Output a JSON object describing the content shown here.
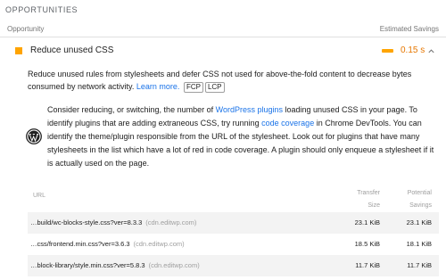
{
  "section": {
    "title": "OPPORTUNITIES"
  },
  "columns": {
    "opportunity": "Opportunity",
    "estimated_savings": "Estimated Savings"
  },
  "audit": {
    "title": "Reduce unused CSS",
    "savings": "0.15 s",
    "accent_color": "#ffa400",
    "expand_icon": "chevron-up-icon"
  },
  "description": {
    "text": "Reduce unused rules from stylesheets and defer CSS not used for above-the-fold content to decrease bytes consumed by network activity. ",
    "learn_more": "Learn more.",
    "tags": [
      "FCP",
      "LCP"
    ]
  },
  "tip": {
    "icon": "wordpress-logo-icon",
    "part1": "Consider reducing, or switching, the number of ",
    "link1": "WordPress plugins",
    "part2": " loading unused CSS in your page. To identify plugins that are adding extraneous CSS, try running ",
    "link2": "code coverage",
    "part3": " in Chrome DevTools. You can identify the theme/plugin responsible from the URL of the stylesheet. Look out for plugins that have many stylesheets in the list which have a lot of red in code coverage. A plugin should only enqueue a stylesheet if it is actually used on the page."
  },
  "table": {
    "headers": {
      "url": "URL",
      "transfer_line1": "Transfer",
      "transfer_line2": "Size",
      "potential_line1": "Potential",
      "potential_line2": "Savings"
    },
    "rows": [
      {
        "url": "…build/wc-blocks-style.css?ver=8.3.3",
        "host": "(cdn.editwp.com)",
        "transfer": "23.1 KiB",
        "savings": "23.1 KiB"
      },
      {
        "url": "…css/frontend.min.css?ver=3.6.3",
        "host": "(cdn.editwp.com)",
        "transfer": "18.5 KiB",
        "savings": "18.1 KiB"
      },
      {
        "url": "…block-library/style.min.css?ver=5.8.3",
        "host": "(cdn.editwp.com)",
        "transfer": "11.7 KiB",
        "savings": "11.7 KiB"
      }
    ]
  }
}
